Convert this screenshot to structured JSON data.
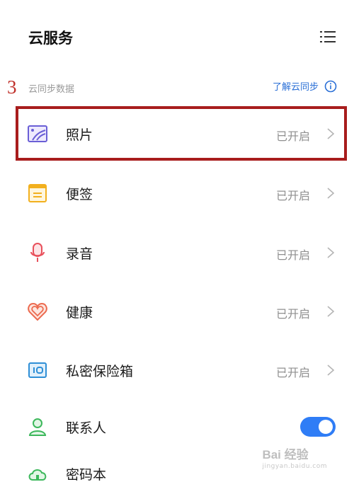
{
  "header": {
    "title": "云服务",
    "menu_icon": "list-menu-icon"
  },
  "annotation": {
    "step_number": "3",
    "color": "#c0302a"
  },
  "section": {
    "label": "云同步数据",
    "learn_more": "了解云同步",
    "learn_more_color": "#2a6fd6"
  },
  "items": [
    {
      "label": "照片",
      "status": "已开启",
      "icon": "photo-icon",
      "control": "chevron"
    },
    {
      "label": "便签",
      "status": "已开启",
      "icon": "note-icon",
      "control": "chevron"
    },
    {
      "label": "录音",
      "status": "已开启",
      "icon": "microphone-icon",
      "control": "chevron"
    },
    {
      "label": "健康",
      "status": "已开启",
      "icon": "health-heart-icon",
      "control": "chevron"
    },
    {
      "label": "私密保险箱",
      "status": "已开启",
      "icon": "safe-box-icon",
      "control": "chevron"
    },
    {
      "label": "联系人",
      "icon": "contact-person-icon",
      "control": "toggle",
      "toggle_on": true
    },
    {
      "label": "密码本",
      "icon": "password-book-icon",
      "control": "toggle",
      "toggle_on": false
    }
  ],
  "accent_color": "#2f7df6",
  "highlight_color": "#a81d1d",
  "watermark": {
    "main": "Bai 经验",
    "sub": "jingyan.baidu.com"
  }
}
